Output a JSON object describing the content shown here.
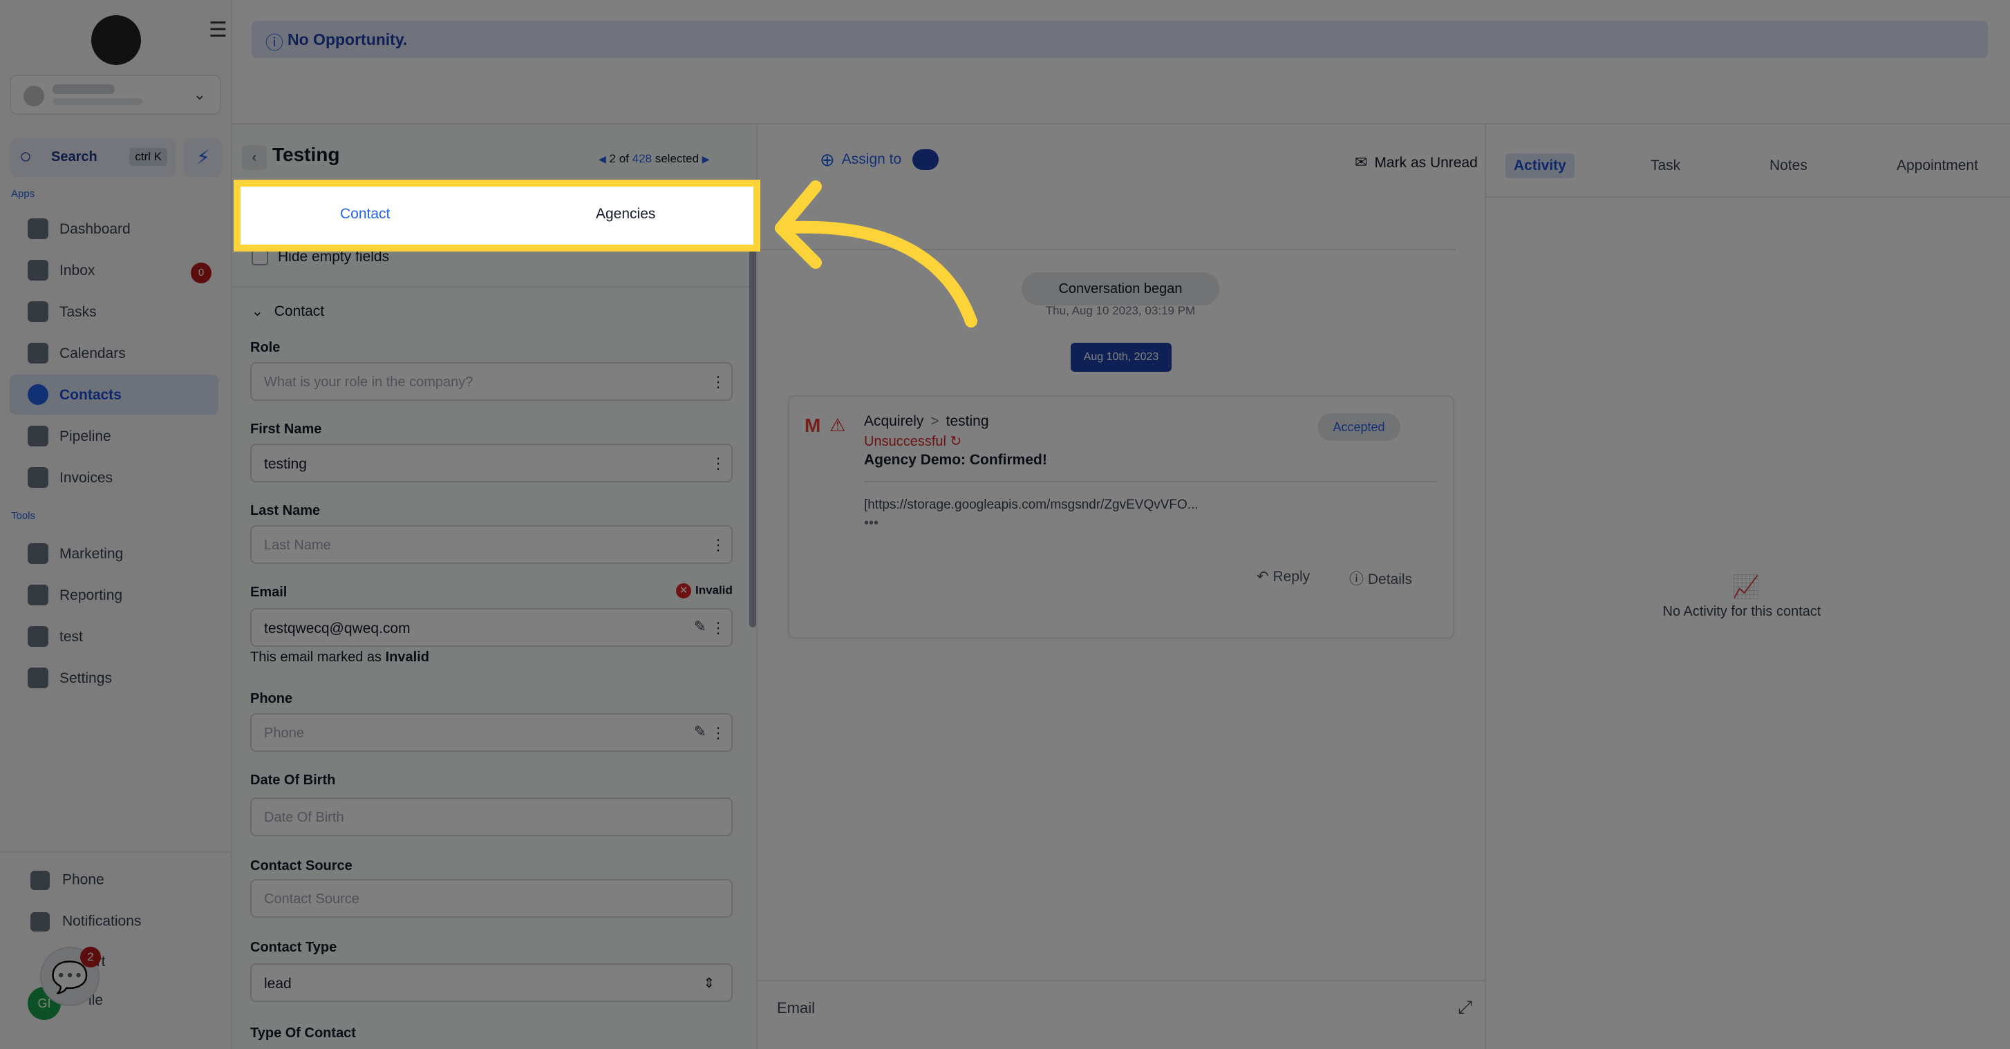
{
  "sidebar": {
    "search_label": "Search",
    "search_shortcut": "ctrl K",
    "apps_label": "Apps",
    "tools_label": "Tools",
    "items": [
      {
        "label": "Dashboard"
      },
      {
        "label": "Inbox",
        "badge": "0"
      },
      {
        "label": "Tasks"
      },
      {
        "label": "Calendars"
      },
      {
        "label": "Contacts",
        "active": true
      },
      {
        "label": "Pipeline"
      },
      {
        "label": "Invoices"
      }
    ],
    "tools": [
      {
        "label": "Marketing"
      },
      {
        "label": "Reporting"
      },
      {
        "label": "test"
      },
      {
        "label": "Settings"
      }
    ],
    "bottom": [
      {
        "label": "Phone"
      },
      {
        "label": "Notifications"
      },
      {
        "label": "ort"
      },
      {
        "label": "ile"
      }
    ],
    "chat_badge": "2",
    "user_initials": "GI"
  },
  "banner": {
    "text": "No Opportunity."
  },
  "contact_panel": {
    "title": "Testing",
    "pager_prefix": "2 of",
    "pager_count": "428",
    "pager_suffix": "selected",
    "tabs": [
      "Contact",
      "Agencies"
    ],
    "hide_empty": "Hide empty fields",
    "section": "Contact",
    "fields": {
      "role_label": "Role",
      "role_placeholder": "What is your role in the company?",
      "first_name_label": "First Name",
      "first_name_value": "testing",
      "last_name_label": "Last Name",
      "last_name_placeholder": "Last Name",
      "email_label": "Email",
      "email_status": "Invalid",
      "email_value": "testqwecq@qweq.com",
      "email_helper_prefix": "This email marked as",
      "email_helper_status": "Invalid",
      "phone_label": "Phone",
      "phone_placeholder": "Phone",
      "dob_label": "Date Of Birth",
      "dob_placeholder": "Date Of Birth",
      "source_label": "Contact Source",
      "source_placeholder": "Contact Source",
      "type_label": "Contact Type",
      "type_value": "lead",
      "type_of_contact_label": "Type Of Contact"
    }
  },
  "conversation": {
    "assign_label": "Assign to",
    "began_label": "Conversation began",
    "began_time": "Thu, Aug 10 2023, 03:19 PM",
    "date_chip": "Aug 10th, 2023",
    "message": {
      "from": "Acquirely",
      "to": "testing",
      "status": "Unsuccessful",
      "subject": "Agency Demo: Confirmed!",
      "badge": "Accepted",
      "body": "[https://storage.googleapis.com/msgsndr/ZgvEVQvVFO...",
      "reply_label": "Reply",
      "details_label": "Details"
    },
    "compose_label": "Email"
  },
  "right_panel": {
    "mark_unread": "Mark as Unread",
    "tabs": [
      "Activity",
      "Task",
      "Notes",
      "Appointment"
    ],
    "empty_text": "No Activity for this contact"
  },
  "colors": {
    "accent": "#2563eb",
    "highlight": "#fdd33a",
    "error": "#dc2626"
  }
}
